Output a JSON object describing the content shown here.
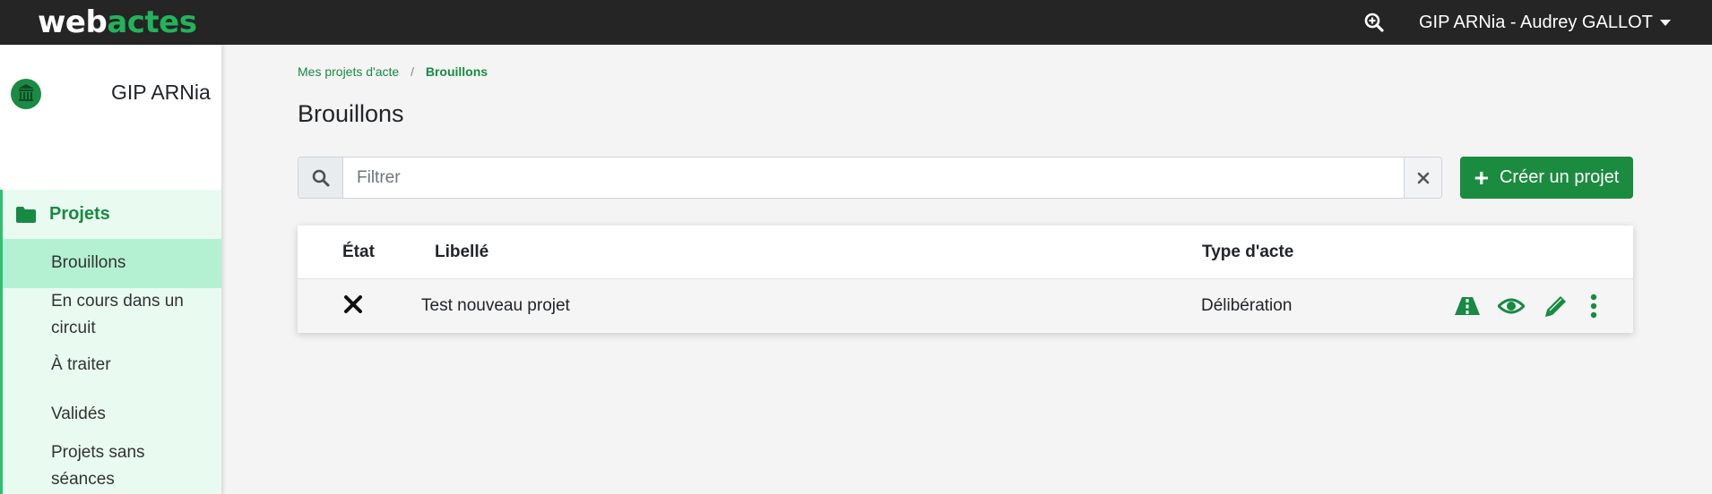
{
  "brand": {
    "part1": "web",
    "part2": "actes"
  },
  "topbar": {
    "user_label": "GIP ARNia - Audrey GALLOT"
  },
  "sidebar": {
    "org_name": "GIP ARNia",
    "section_label": "Projets",
    "items": [
      {
        "label": "Brouillons",
        "active": true
      },
      {
        "label": "En cours dans un circuit",
        "active": false
      },
      {
        "label": "À traiter",
        "active": false
      },
      {
        "label": "Validés",
        "active": false
      },
      {
        "label": "Projets sans séances",
        "active": false
      }
    ]
  },
  "breadcrumb": {
    "parent": "Mes projets d'acte",
    "separator": "/",
    "current": "Brouillons"
  },
  "page_title": "Brouillons",
  "filter": {
    "placeholder": "Filtrer",
    "value": ""
  },
  "create_button": {
    "label": "Créer un projet"
  },
  "table": {
    "columns": {
      "state": "État",
      "label": "Libellé",
      "type": "Type d'acte"
    },
    "rows": [
      {
        "state_icon": "close-icon",
        "label": "Test nouveau projet",
        "type": "Délibération",
        "actions": [
          "road-icon",
          "eye-icon",
          "pencil-icon",
          "more-vertical-icon"
        ]
      }
    ]
  },
  "colors": {
    "topbar": "#252525",
    "brand_green": "#23b35b",
    "primary": "#1b8b3f",
    "nav_bg": "#e9fbf0",
    "nav_active": "#b4f1d2"
  }
}
